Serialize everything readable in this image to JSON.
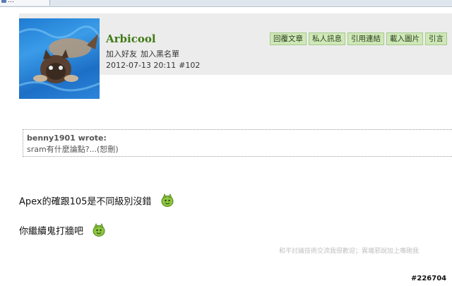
{
  "browser": {
    "tab_title": "…"
  },
  "post": {
    "username": "Arbicool",
    "user_links": [
      "加入好友",
      "加入黑名單"
    ],
    "date": "2012-07-13 20:11",
    "post_number": "#102",
    "actions": [
      "回覆文章",
      "私人訊息",
      "引用連結",
      "載入圖片",
      "引言"
    ]
  },
  "quote": {
    "author": "benny1901 wrote:",
    "text": "sram有什麼論點?...(恕刪)"
  },
  "body": {
    "line1": "Apex的確跟105是不同級別沒錯",
    "line2": "你繼續鬼打牆吧",
    "emoticon": "smile-emoticon-icon"
  },
  "footer_note": "和平討論技術交流我很歡迎；異端邪說加上嘴砲我",
  "watermark": "#226704",
  "colors": {
    "username": "#3f7a16",
    "action_bg": "#cfe8b8",
    "header_bg": "#ececec"
  }
}
